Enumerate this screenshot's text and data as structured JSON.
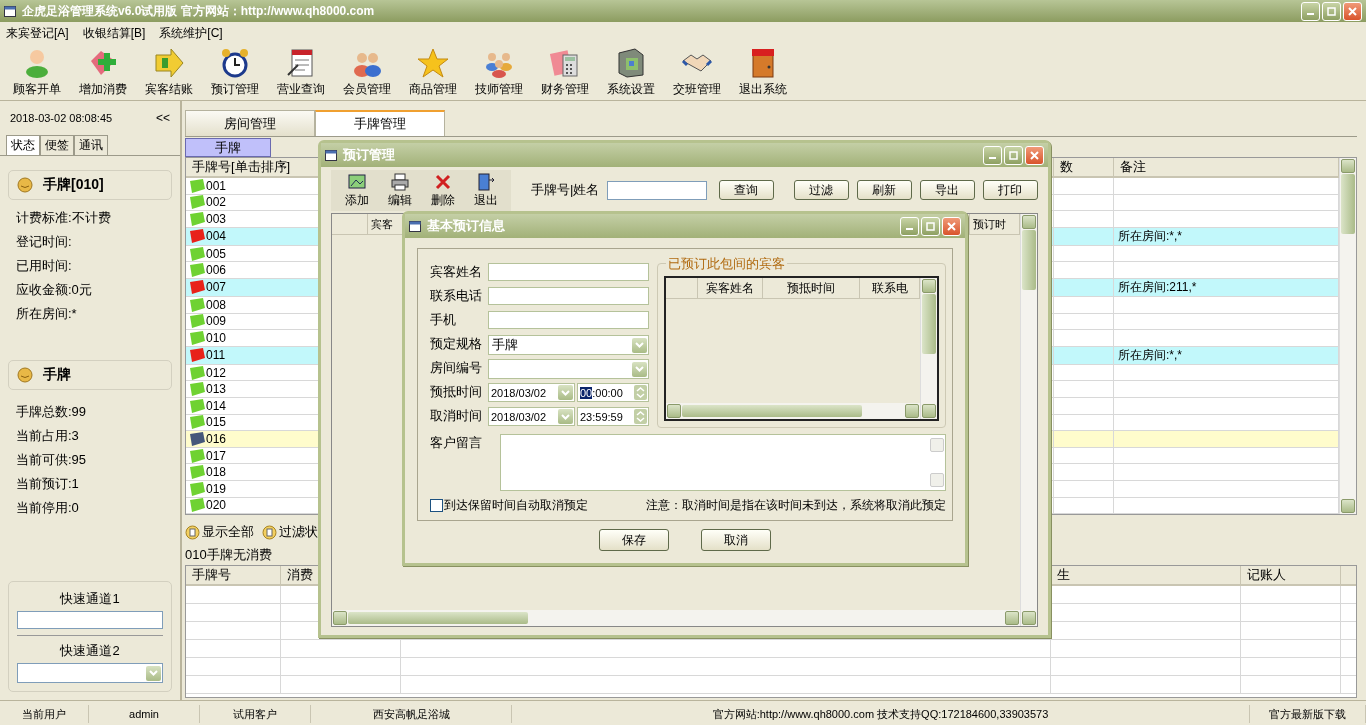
{
  "window": {
    "title": "企虎足浴管理系统v6.0试用版 官方网站：http://www.qh8000.com"
  },
  "menu": [
    "来宾登记[A]",
    "收银结算[B]",
    "系统维护[C]"
  ],
  "toolbar": [
    "顾客开单",
    "增加消费",
    "宾客结账",
    "预订管理",
    "营业查询",
    "会员管理",
    "商品管理",
    "技师管理",
    "财务管理",
    "系统设置",
    "交班管理",
    "退出系统"
  ],
  "left_panel": {
    "datetime": "2018-03-02 08:08:45",
    "collapse": "<<",
    "tabs": [
      {
        "label": "状态",
        "selected": true
      },
      {
        "label": "便签",
        "selected": false
      },
      {
        "label": "通讯",
        "selected": false
      }
    ],
    "card": {
      "title": "手牌[010]",
      "lines": [
        "计费标准:不计费",
        "登记时间:",
        "已用时间:",
        "应收金额:0元",
        "所在房间:*"
      ]
    },
    "summary": {
      "title": "手牌",
      "lines": [
        "手牌总数:99",
        "当前占用:3",
        "当前可供:95",
        "当前预订:1",
        "当前停用:0"
      ]
    },
    "quick": [
      {
        "label": "快速通道1",
        "kind": "input"
      },
      {
        "label": "快速通道2",
        "kind": "select"
      }
    ]
  },
  "main_tabs": [
    {
      "label": "房间管理",
      "selected": false
    },
    {
      "label": "手牌管理",
      "selected": true
    }
  ],
  "sub_tab": "手牌",
  "table": {
    "columns": [
      "手牌号[单击排序]",
      "数",
      "备注"
    ],
    "rows": [
      {
        "number": "001",
        "kind": "free"
      },
      {
        "number": "002",
        "kind": "free"
      },
      {
        "number": "003",
        "kind": "free"
      },
      {
        "number": "004",
        "kind": "occupied",
        "note": "所在房间:*,*"
      },
      {
        "number": "005",
        "kind": "free"
      },
      {
        "number": "006",
        "kind": "free"
      },
      {
        "number": "007",
        "kind": "occupied",
        "note": "所在房间:211,*"
      },
      {
        "number": "008",
        "kind": "free"
      },
      {
        "number": "009",
        "kind": "free"
      },
      {
        "number": "010",
        "kind": "free"
      },
      {
        "number": "011",
        "kind": "occupied",
        "note": "所在房间:*,*"
      },
      {
        "number": "012",
        "kind": "free"
      },
      {
        "number": "013",
        "kind": "free"
      },
      {
        "number": "014",
        "kind": "free"
      },
      {
        "number": "015",
        "kind": "free"
      },
      {
        "number": "016",
        "kind": "reserved"
      },
      {
        "number": "017",
        "kind": "free"
      },
      {
        "number": "018",
        "kind": "free"
      },
      {
        "number": "019",
        "kind": "free"
      },
      {
        "number": "020",
        "kind": "free"
      }
    ]
  },
  "filter_buttons": [
    "显示全部",
    "过滤状"
  ],
  "consumption_caption": "010手牌无消费",
  "consumption_table": {
    "columns": [
      "手牌号",
      "消费",
      "生",
      "记账人"
    ]
  },
  "booking_window": {
    "title": "预订管理",
    "tools": [
      "添加",
      "编辑",
      "删除",
      "退出"
    ],
    "search_label": "手牌号|姓名",
    "buttons": [
      "查询",
      "过滤",
      "刷新",
      "导出",
      "打印"
    ],
    "columns": [
      "宾客",
      "预订时"
    ]
  },
  "booking_form": {
    "title": "基本预订信息",
    "fields": [
      {
        "label": "宾客姓名",
        "kind": "text"
      },
      {
        "label": "联系电话",
        "kind": "text"
      },
      {
        "label": "手机",
        "kind": "text"
      },
      {
        "label": "预定规格",
        "kind": "select",
        "value": "手牌"
      },
      {
        "label": "房间编号",
        "kind": "select"
      },
      {
        "label": "预抵时间",
        "kind": "datetime",
        "date": "2018/03/02",
        "hour": "00",
        "rest": ":00:00",
        "hour_selected": true
      },
      {
        "label": "取消时间",
        "kind": "datetime",
        "date": "2018/03/02",
        "hour": "23",
        "rest": ":59:59",
        "hour_selected": false
      }
    ],
    "guests_title": "已预订此包间的宾客",
    "guest_columns": [
      "宾客姓名",
      "预抵时间",
      "联系电"
    ],
    "message_label": "客户留言",
    "auto_cancel": {
      "label": "到达保留时间自动取消预定",
      "checked": false
    },
    "note": "注意：取消时间是指在该时间未到达，系统将取消此预定",
    "buttons": [
      "保存",
      "取消"
    ]
  },
  "status_bar": [
    "当前用户",
    "admin",
    "试用客户",
    "西安高帆足浴城",
    "官方网站:http://www.qh8000.com 技术支持QQ:172184600,33903573",
    "官方最新版下载"
  ]
}
